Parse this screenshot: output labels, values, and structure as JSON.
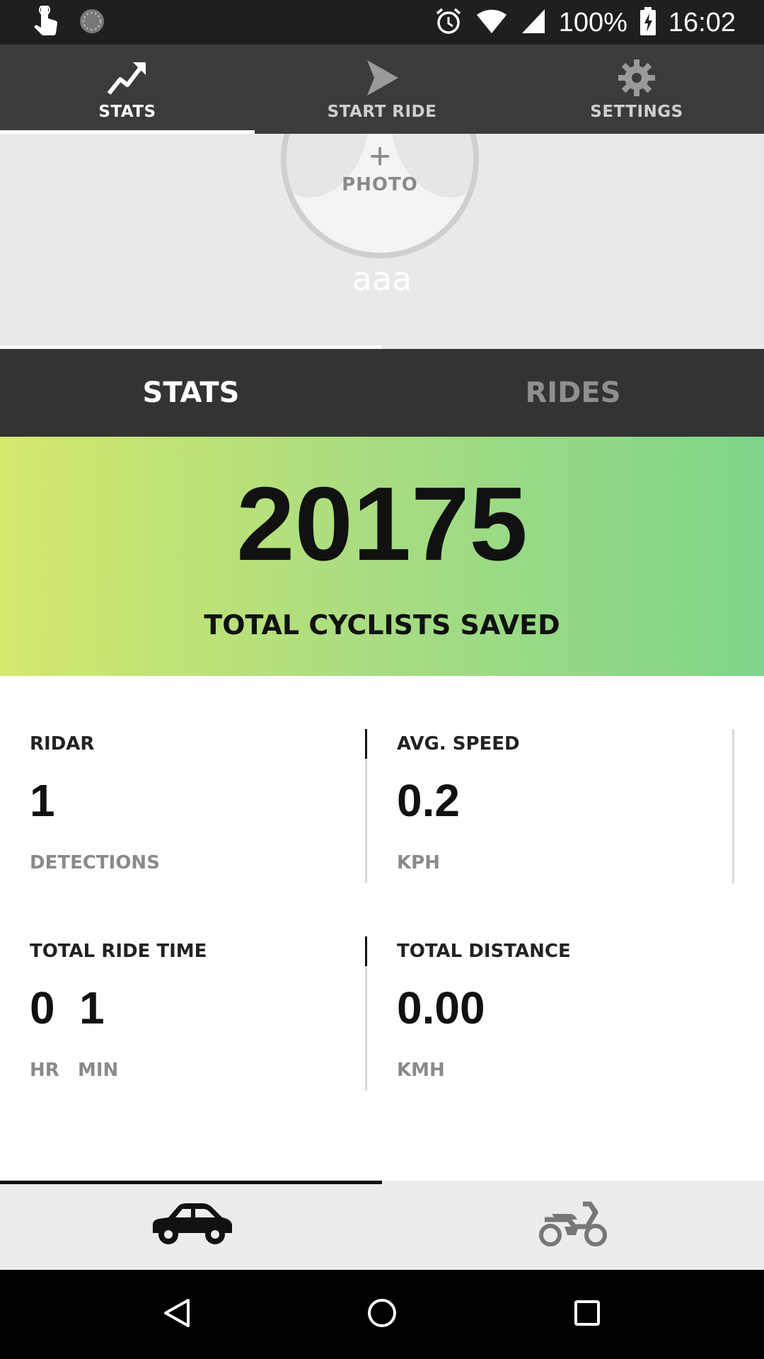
{
  "status_bar": {
    "battery": "100%",
    "time": "16:02"
  },
  "top_tabs": [
    {
      "label": "STATS",
      "icon": "trending-up-icon",
      "active": true
    },
    {
      "label": "START RIDE",
      "icon": "play-icon",
      "active": false
    },
    {
      "label": "SETTINGS",
      "icon": "gear-icon",
      "active": false
    }
  ],
  "profile": {
    "photo_plus": "+",
    "photo_label": "PHOTO",
    "username": "aaa"
  },
  "sub_tabs": [
    {
      "label": "STATS",
      "active": true
    },
    {
      "label": "RIDES",
      "active": false
    }
  ],
  "hero": {
    "value": "20175",
    "label": "TOTAL CYCLISTS SAVED"
  },
  "stats": {
    "ridar": {
      "title": "RIDAR",
      "value": "1",
      "unit": "DETECTIONS"
    },
    "avg_speed": {
      "title": "AVG. SPEED",
      "value": "0.2",
      "unit": "KPH"
    },
    "ride_time": {
      "title": "TOTAL RIDE TIME",
      "hours": "0",
      "minutes": "1",
      "hours_unit": "HR",
      "minutes_unit": "MIN"
    },
    "distance": {
      "title": "TOTAL DISTANCE",
      "value": "0.00",
      "unit": "KMH"
    }
  },
  "vehicle_tabs": [
    {
      "icon": "car-icon",
      "active": true
    },
    {
      "icon": "motorcycle-icon",
      "active": false
    }
  ],
  "nav_bar": {
    "icons": [
      "back-icon",
      "home-icon",
      "recents-icon"
    ]
  },
  "colors": {
    "hero_gradient_start": "#d4e86d",
    "hero_gradient_end": "#7fd58a",
    "tab_bar": "#3b3b3b",
    "sub_tab_bar": "#333333"
  }
}
